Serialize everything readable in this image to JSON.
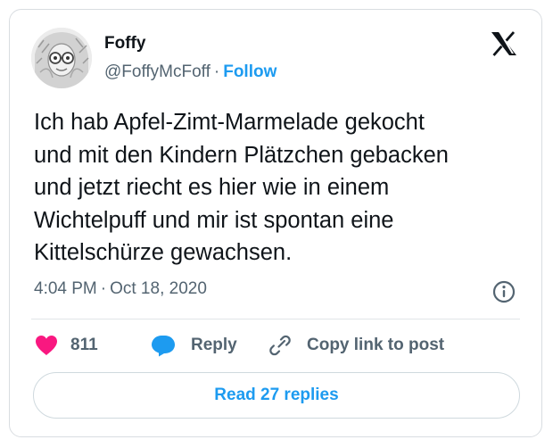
{
  "author": {
    "display_name": "Foffy",
    "handle": "@FoffyMcFoff",
    "separator": "·",
    "follow_label": "Follow"
  },
  "tweet": {
    "text": "Ich hab Apfel-Zimt-Marmelade gekocht\nund mit den Kindern Plätzchen gebacken\nund jetzt riecht es hier wie in einem\nWichtelpuff und mir ist spontan eine\nKittelschürze gewachsen.",
    "time": "4:04 PM",
    "separator": "·",
    "date": "Oct 18, 2020"
  },
  "actions": {
    "like_count": "811",
    "reply_label": "Reply",
    "copy_link_label": "Copy link to post"
  },
  "read_replies_label": "Read 27 replies",
  "icons": {
    "avatar": "avatar-photo",
    "logo": "x-logo-icon",
    "info": "info-icon",
    "like": "heart-icon",
    "reply": "speech-bubble-icon",
    "copy_link": "link-icon"
  },
  "colors": {
    "accent": "#1d9bf0",
    "like": "#f91880",
    "secondary_text": "#536471",
    "primary_text": "#0f1419"
  }
}
